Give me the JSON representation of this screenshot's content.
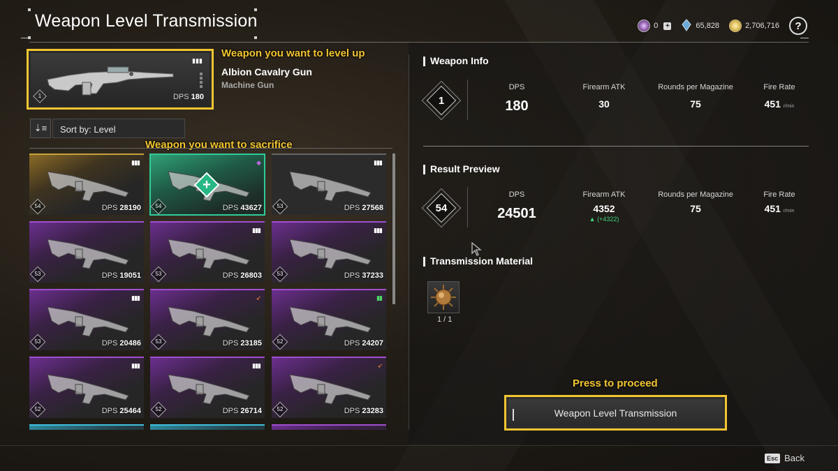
{
  "header": {
    "title": "Weapon Level Transmission",
    "currencies": [
      {
        "icon": "crystal-icon",
        "value": "0",
        "color": "#b98bd0"
      },
      {
        "icon": "kuiper-icon",
        "value": "65,828",
        "color": "#6aa8d8"
      },
      {
        "icon": "gold-coin-icon",
        "value": "2,706,716",
        "color": "#e0c060"
      }
    ],
    "help_label": "?"
  },
  "selected_weapon": {
    "callout": "Weapon you want to level up",
    "name": "Albion Cavalry Gun",
    "type": "Machine Gun",
    "level": "1",
    "dps_label": "DPS",
    "dps": "180"
  },
  "sort": {
    "label": "Sort by: Level"
  },
  "sacrifice_callout": "Weapon you want to sacrifice",
  "grid": {
    "dps_label": "DPS",
    "cards": [
      {
        "level": "54",
        "dps": "28190",
        "rarity": "gold",
        "badge": "ammo-icon"
      },
      {
        "level": "54",
        "dps": "43627",
        "rarity": "selected",
        "badge": "pill-icon"
      },
      {
        "level": "53",
        "dps": "27568",
        "rarity": "plain",
        "badge": "ammo-icon"
      },
      {
        "level": "53",
        "dps": "19051",
        "rarity": "purple",
        "badge": ""
      },
      {
        "level": "53",
        "dps": "26803",
        "rarity": "purple",
        "badge": "ammo-icon"
      },
      {
        "level": "53",
        "dps": "37233",
        "rarity": "purple",
        "badge": "ammo-icon"
      },
      {
        "level": "53",
        "dps": "20486",
        "rarity": "purple",
        "badge": "ammo-icon"
      },
      {
        "level": "53",
        "dps": "23185",
        "rarity": "purple",
        "badge": "rocket-icon"
      },
      {
        "level": "52",
        "dps": "24207",
        "rarity": "purple",
        "badge": "battery-icon"
      },
      {
        "level": "52",
        "dps": "25464",
        "rarity": "purple",
        "badge": "ammo-icon"
      },
      {
        "level": "52",
        "dps": "26714",
        "rarity": "purple",
        "badge": "ammo-icon"
      },
      {
        "level": "52",
        "dps": "23283",
        "rarity": "purple",
        "badge": "rocket-icon"
      },
      {
        "level": "",
        "dps": "",
        "rarity": "cyan",
        "badge": ""
      },
      {
        "level": "",
        "dps": "",
        "rarity": "cyan",
        "badge": ""
      },
      {
        "level": "",
        "dps": "",
        "rarity": "purple",
        "badge": ""
      }
    ]
  },
  "weapon_info": {
    "title": "Weapon Info",
    "level": "1",
    "stats": [
      {
        "label": "DPS",
        "value": "180"
      },
      {
        "label": "Firearm ATK",
        "value": "30"
      },
      {
        "label": "Rounds per Magazine",
        "value": "75"
      },
      {
        "label": "Fire Rate",
        "value": "451",
        "unit": "r/min"
      }
    ]
  },
  "result_preview": {
    "title": "Result Preview",
    "level": "54",
    "stats": [
      {
        "label": "DPS",
        "value": "24501"
      },
      {
        "label": "Firearm ATK",
        "value": "4352",
        "delta": "▲ (+4322)"
      },
      {
        "label": "Rounds per Magazine",
        "value": "75"
      },
      {
        "label": "Fire Rate",
        "value": "451",
        "unit": "r/min"
      }
    ]
  },
  "transmission_material": {
    "title": "Transmission Material",
    "count": "1 / 1"
  },
  "action": {
    "callout": "Press to proceed",
    "button_label": "Weapon Level Transmission"
  },
  "footer": {
    "key": "Esc",
    "label": "Back"
  },
  "colors": {
    "accent": "#f2c531",
    "selected": "#2ecc9a",
    "delta_positive": "#3fd67a"
  }
}
